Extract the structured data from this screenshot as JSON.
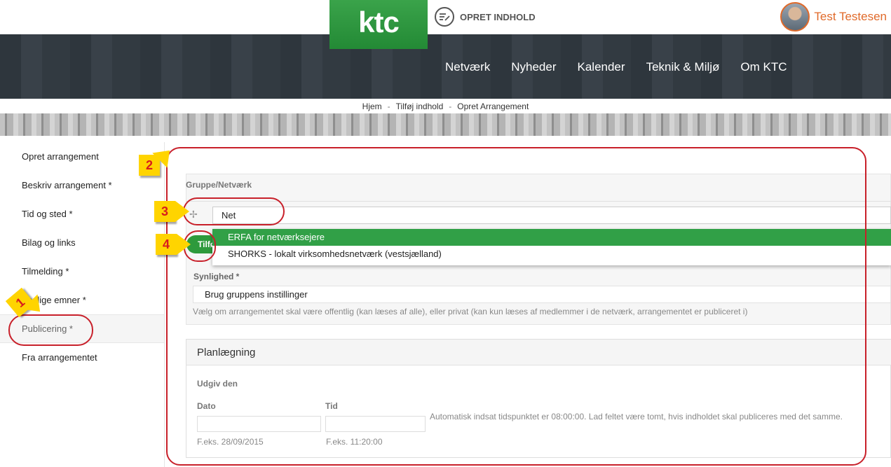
{
  "header": {
    "logo_text": "ktc",
    "create_label": "OPRET INDHOLD",
    "user_name": "Test Testesen",
    "brand_color": "#2e9a3c",
    "accent_color": "#e06a2a"
  },
  "nav": {
    "items": [
      "Netværk",
      "Nyheder",
      "Kalender",
      "Teknik & Miljø",
      "Om KTC"
    ]
  },
  "breadcrumb": {
    "items": [
      "Hjem",
      "Tilføj indhold",
      "Opret Arrangement"
    ],
    "separator": "-"
  },
  "sidebar": {
    "items": [
      {
        "label": "Opret arrangement"
      },
      {
        "label": "Beskriv arrangement *"
      },
      {
        "label": "Tid og sted *"
      },
      {
        "label": "Bilag og links"
      },
      {
        "label": "Tilmelding *"
      },
      {
        "label": "Faglige emner *"
      },
      {
        "label": "Publicering *"
      },
      {
        "label": "Fra arrangementet"
      }
    ],
    "active_index": 6
  },
  "form": {
    "group_label": "Gruppe/Netværk",
    "group_input_value": "Net",
    "add_button_label": "Tilføj",
    "autocomplete": [
      "ERFA for netværksejere",
      "SHORKS - lokalt virksomhedsnetværk (vestsjælland)"
    ],
    "visibility_label": "Synlighed *",
    "visibility_value": "Brug gruppens instillinger",
    "visibility_help": "Vælg om arrangementet skal være offentlig (kan læses af alle), eller privat (kan kun læses af medlemmer i de netværk, arrangementet er publiceret i)"
  },
  "planning": {
    "title": "Planlægning",
    "publish_label": "Udgiv den",
    "date_label": "Dato",
    "time_label": "Tid",
    "auto_note": "Automatisk indsat tidspunktet er 08:00:00. Lad feltet være tomt, hvis indholdet skal publiceres med det samme.",
    "date_hint": "F.eks. 28/09/2015",
    "time_hint": "F.eks. 11:20:00"
  },
  "annotations": [
    "1",
    "2",
    "3",
    "4"
  ]
}
